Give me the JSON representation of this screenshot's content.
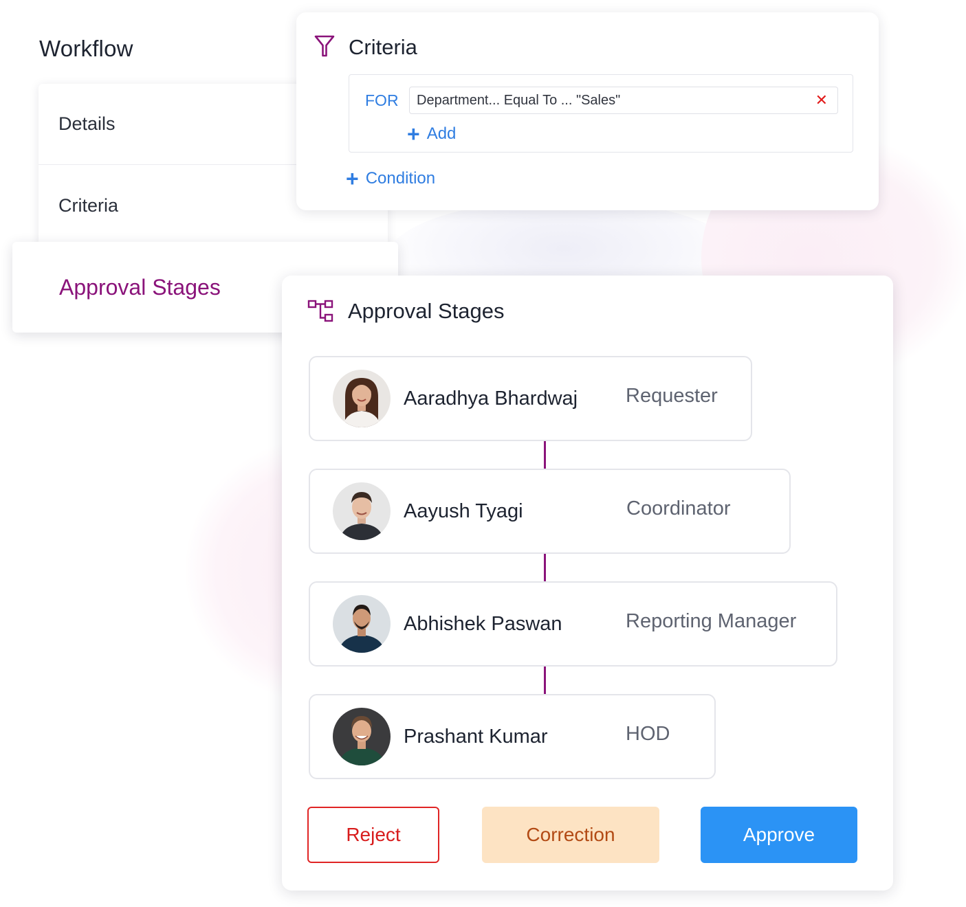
{
  "workflow": {
    "title": "Workflow",
    "nav": {
      "details": "Details",
      "criteria": "Criteria",
      "approval_stages": "Approval Stages"
    }
  },
  "criteria": {
    "title": "Criteria",
    "icon": "filter-icon",
    "for_label": "FOR",
    "rule": "Department... Equal To ... \"Sales\"",
    "remove_icon": "close-icon",
    "add_label": "Add",
    "condition_label": "Condition"
  },
  "approval": {
    "title": "Approval Stages",
    "icon": "hierarchy-icon",
    "stages": [
      {
        "name": "Aaradhya Bhardwaj",
        "role": "Requester"
      },
      {
        "name": "Aayush Tyagi",
        "role": "Coordinator"
      },
      {
        "name": "Abhishek Paswan",
        "role": "Reporting Manager"
      },
      {
        "name": "Prashant Kumar",
        "role": "HOD"
      }
    ],
    "buttons": {
      "reject": "Reject",
      "correction": "Correction",
      "approve": "Approve"
    }
  },
  "colors": {
    "accent_purple": "#8a137a",
    "link_blue": "#2f7de1",
    "reject_red": "#e02424",
    "correction_bg": "#fde3c3",
    "correction_text": "#b24a14",
    "approve_blue": "#2b93f5"
  }
}
